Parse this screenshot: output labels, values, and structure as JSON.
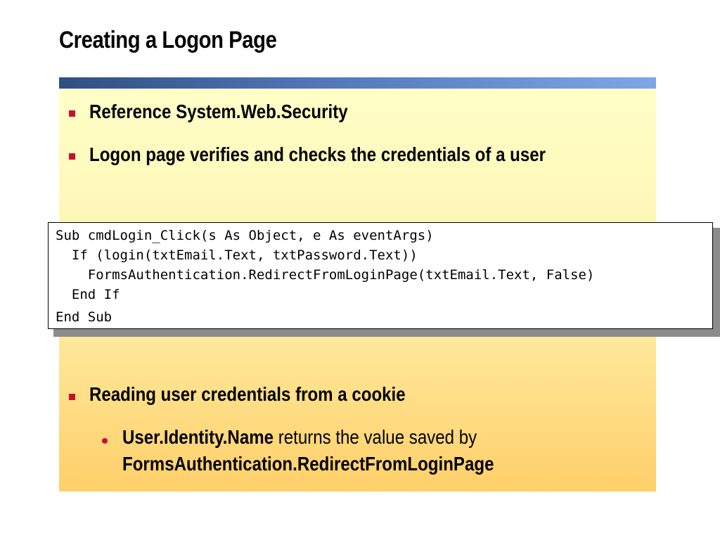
{
  "slide": {
    "title": "Creating a Logon Page",
    "bullets": [
      "Reference System.Web.Security",
      "Logon page verifies and checks the credentials of a user",
      "Reading user credentials from a cookie"
    ],
    "code": [
      "Sub cmdLogin_Click(s As Object, e As eventArgs)",
      "  If (login(txtEmail.Text, txtPassword.Text))",
      "    FormsAuthentication.RedirectFromLoginPage(txtEmail.Text, False)",
      "  End If",
      "End Sub"
    ],
    "sub_bullet": {
      "bold_1": "User.Identity.Name",
      "text_1": " returns the value saved by",
      "bold_2": "FormsAuthentication.RedirectFromLoginPage"
    }
  },
  "colors": {
    "bullet_marker": "#c8102e",
    "header_bar_start": "#2f4f83",
    "header_bar_end": "#7fa6e6",
    "panel_top": "#ffffc8",
    "panel_bottom": "#ffcf6a"
  }
}
